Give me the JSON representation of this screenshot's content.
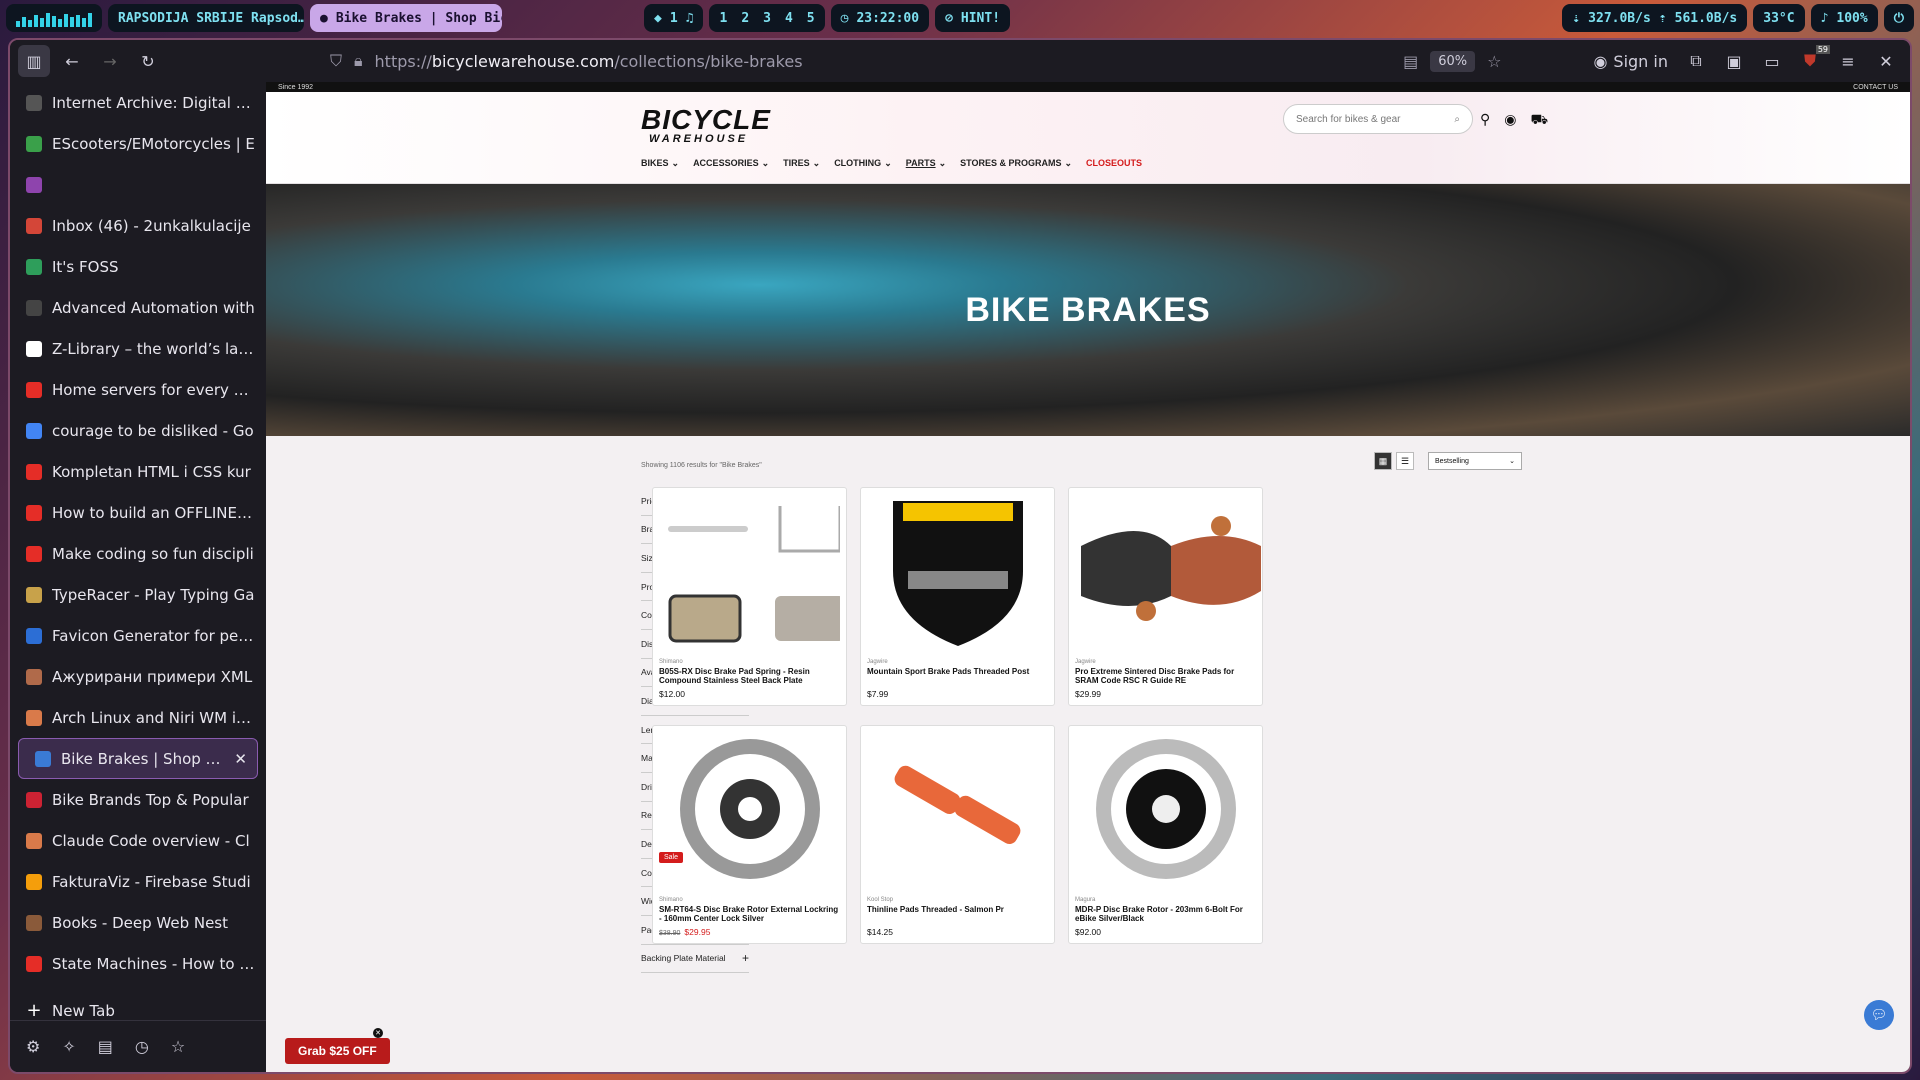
{
  "topbar": {
    "media": "RAPSODIJA SRBIJE  Rapsod…",
    "active_window": "Bike Brakes | Shop Bicy…",
    "ws_left": "1",
    "workspaces": [
      "1",
      "2",
      "3",
      "4",
      "5"
    ],
    "time": "23:22:00",
    "hint": "HINT!",
    "net_down": "327.0B/s",
    "net_up": "561.0B/s",
    "temp": "33°C",
    "volume": "100%"
  },
  "browser": {
    "url_prefix": "https://",
    "url_host": "bicyclewarehouse.com",
    "url_path": "/collections/bike-brakes",
    "zoom": "60%",
    "sign_in": "Sign in",
    "badge": "59"
  },
  "sidebar": {
    "tabs": [
      {
        "title": "Internet Archive: Digital Libr",
        "color": "#555",
        "icon": "archive-icon"
      },
      {
        "title": "EScooters/EMotorcycles | E",
        "color": "#3aa04a",
        "icon": "globe-icon"
      },
      {
        "title": "",
        "color": "#8e44ad",
        "icon": "purple-square-icon"
      },
      {
        "title": "Inbox (46) - 2unkalkulacije",
        "color": "#d44638",
        "icon": "gmail-icon"
      },
      {
        "title": "It's FOSS",
        "color": "#2e9e5b",
        "icon": "foss-icon"
      },
      {
        "title": "Advanced Automation with",
        "color": "#444",
        "icon": "robot-icon"
      },
      {
        "title": "Z-Library – the world’s large",
        "color": "#fff",
        "icon": "zlib-icon"
      },
      {
        "title": "Home servers for every bud",
        "color": "#e52d27",
        "icon": "youtube-icon"
      },
      {
        "title": "courage to be disliked - Go",
        "color": "#4285f4",
        "icon": "google-icon"
      },
      {
        "title": "Kompletan HTML i CSS kur",
        "color": "#e52d27",
        "icon": "youtube-icon"
      },
      {
        "title": "How to build an OFFLINE m",
        "color": "#e52d27",
        "icon": "youtube-icon"
      },
      {
        "title": "Make coding so fun discipli",
        "color": "#e52d27",
        "icon": "youtube-icon"
      },
      {
        "title": "TypeRacer - Play Typing Ga",
        "color": "#c8a24a",
        "icon": "typeracer-icon"
      },
      {
        "title": "Favicon Generator for perfe",
        "color": "#2c6ed5",
        "icon": "favicon-icon"
      },
      {
        "title": "Ажурирани примери XML",
        "color": "#b06a4a",
        "icon": "doc-icon"
      },
      {
        "title": "Arch Linux and Niri WM inst",
        "color": "#d97a4a",
        "icon": "claude-icon"
      },
      {
        "title": "Bike Brakes | Shop Bicyc",
        "color": "#3a7bd5",
        "icon": "bicycle-icon"
      },
      {
        "title": "Bike Brands Top & Popular",
        "color": "#c23",
        "icon": "bike-brands-icon"
      },
      {
        "title": "Claude Code overview - Cl",
        "color": "#d97a4a",
        "icon": "claude-icon"
      },
      {
        "title": "FakturaViz - Firebase Studi",
        "color": "#f59e0b",
        "icon": "firebase-icon"
      },
      {
        "title": "Books - Deep Web Nest",
        "color": "#8a5a3a",
        "icon": "book-icon"
      },
      {
        "title": "State Machines - How to en",
        "color": "#e52d27",
        "icon": "youtube-icon"
      }
    ],
    "new_tab": "New Tab"
  },
  "site": {
    "since": "Since 1992",
    "contact": "CONTACT US",
    "logo_top": "BICYCLE",
    "logo_bottom": "WAREHOUSE",
    "search_placeholder": "Search for bikes & gear",
    "menu": [
      "BIKES",
      "ACCESSORIES",
      "TIRES",
      "CLOTHING",
      "PARTS",
      "STORES & PROGRAMS",
      "CLOSEOUTS"
    ],
    "hero_title": "BIKE BRAKES",
    "results": "Showing 1106 results for \"Bike Brakes\"",
    "sort": "Bestselling",
    "filters": [
      "Price, $",
      "Brand",
      "Size",
      "Product type",
      "Color",
      "Discount",
      "Availability",
      "Diameter",
      "Length",
      "Material",
      "Drivetrain Speeds",
      "Reach",
      "Designed for ebike",
      "Compound",
      "Width",
      "Pad Shape Number",
      "Backing Plate Material"
    ],
    "products": [
      {
        "brand": "Shimano",
        "name": "B05S-RX Disc Brake Pad Spring - Resin Compound Stainless Steel Back Plate",
        "price": "$12.00",
        "old": "",
        "sale": ""
      },
      {
        "brand": "Jagwire",
        "name": "Mountain Sport Brake Pads Threaded Post",
        "price": "$7.99",
        "old": "",
        "sale": ""
      },
      {
        "brand": "Jagwire",
        "name": "Pro Extreme Sintered Disc Brake Pads for SRAM Code RSC R Guide RE",
        "price": "$29.99",
        "old": "",
        "sale": ""
      },
      {
        "brand": "Shimano",
        "name": "SM-RT64-S Disc Brake Rotor External Lockring - 160mm Center Lock Silver",
        "price": "",
        "old": "$38.90",
        "sale": "$29.95",
        "badge": "Sale"
      },
      {
        "brand": "Kool Stop",
        "name": "Thinline Pads Threaded - Salmon Pr",
        "price": "$14.25",
        "old": "",
        "sale": ""
      },
      {
        "brand": "Magura",
        "name": "MDR-P Disc Brake Rotor - 203mm 6-Bolt For eBike Silver/Black",
        "price": "$92.00",
        "old": "",
        "sale": ""
      }
    ],
    "promo": "Grab $25 OFF"
  }
}
